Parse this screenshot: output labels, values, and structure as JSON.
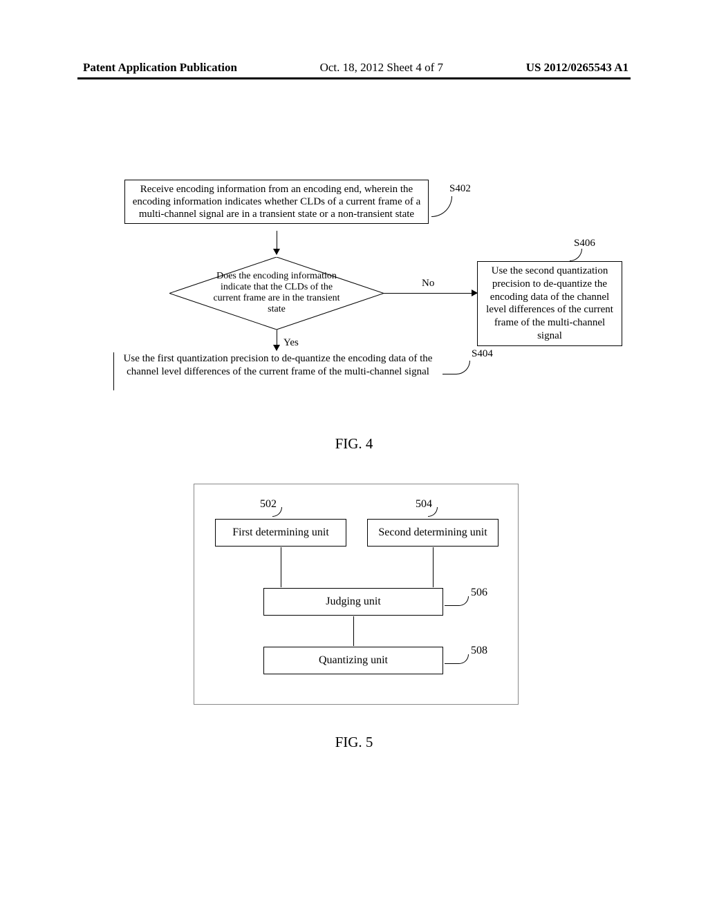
{
  "header": {
    "left": "Patent Application Publication",
    "center": "Oct. 18, 2012  Sheet 4 of 7",
    "right": "US 2012/0265543 A1"
  },
  "fig4": {
    "box402": "Receive encoding information from an encoding end, wherein the encoding information indicates whether CLDs of a current frame of a multi-channel signal are in a transient state or a non-transient state",
    "label402": "S402",
    "diamond": "Does the encoding information indicate that the CLDs of the current frame are in the transient state",
    "no": "No",
    "yes": "Yes",
    "box406": "Use the second quantization precision to de-quantize the encoding data of the channel level differences of the current frame of the multi-channel signal",
    "label406": "S406",
    "text404": "Use the first quantization precision to de-quantize the encoding data of the channel level differences of the current frame of the multi-channel signal",
    "label404": "S404",
    "caption": "FIG. 4"
  },
  "fig5": {
    "box502": "First determining unit",
    "label502": "502",
    "box504": "Second determining unit",
    "label504": "504",
    "box506": "Judging unit",
    "label506": "506",
    "box508": "Quantizing unit",
    "label508": "508",
    "caption": "FIG. 5"
  }
}
